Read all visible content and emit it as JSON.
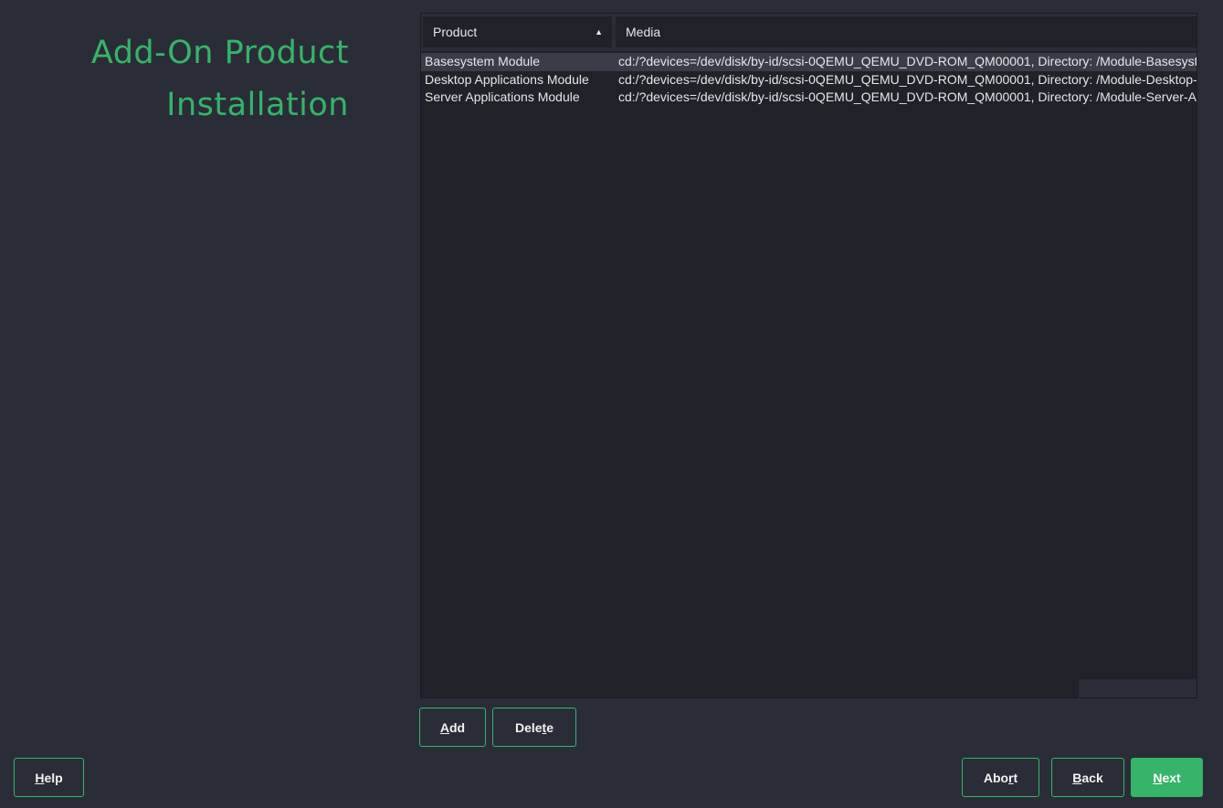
{
  "title": {
    "line1": "Add-On Product",
    "line2": "Installation"
  },
  "table": {
    "columns": {
      "product": "Product",
      "media": "Media"
    },
    "sort_icon": "sort-ascending-icon",
    "rows": [
      {
        "product": "Basesystem Module",
        "media": "cd:/?devices=/dev/disk/by-id/scsi-0QEMU_QEMU_DVD-ROM_QM00001, Directory: /Module-Basesystem",
        "selected": true
      },
      {
        "product": "Desktop Applications Module",
        "media": "cd:/?devices=/dev/disk/by-id/scsi-0QEMU_QEMU_DVD-ROM_QM00001, Directory: /Module-Desktop-Applications",
        "selected": false
      },
      {
        "product": "Server Applications Module",
        "media": "cd:/?devices=/dev/disk/by-id/scsi-0QEMU_QEMU_DVD-ROM_QM00001, Directory: /Module-Server-Applications",
        "selected": false
      }
    ]
  },
  "buttons": {
    "add": {
      "pre": "",
      "key": "A",
      "post": "dd"
    },
    "delete": {
      "pre": "Dele",
      "key": "t",
      "post": "e"
    },
    "help": {
      "pre": "",
      "key": "H",
      "post": "elp"
    },
    "abort": {
      "pre": "Abo",
      "key": "r",
      "post": "t"
    },
    "back": {
      "pre": "",
      "key": "B",
      "post": "ack"
    },
    "next": {
      "pre": "",
      "key": "N",
      "post": "ext"
    }
  },
  "colors": {
    "accent": "#35b46a",
    "background": "#2a2d37",
    "table_background": "#1f2229"
  }
}
